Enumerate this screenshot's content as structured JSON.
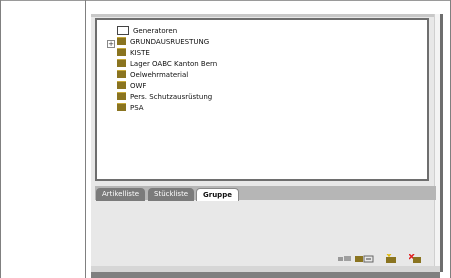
{
  "tree": {
    "items": [
      {
        "label": "Generatoren",
        "type": "root"
      },
      {
        "label": "GRUNDAUSRUESTUNG",
        "type": "folder",
        "expandable": true
      },
      {
        "label": "KISTE",
        "type": "folder"
      },
      {
        "label": "Lager OABC Kanton Bern",
        "type": "folder"
      },
      {
        "label": "Oelwehrmaterial",
        "type": "folder"
      },
      {
        "label": "OWF",
        "type": "folder"
      },
      {
        "label": "Pers. Schutzausrüstung",
        "type": "folder"
      },
      {
        "label": "PSA",
        "type": "folder"
      }
    ],
    "expand_symbol": "+"
  },
  "tabs": [
    {
      "label": "Artikelliste",
      "active": false
    },
    {
      "label": "Stückliste",
      "active": false
    },
    {
      "label": "Gruppe",
      "active": true
    }
  ],
  "toolbar": {
    "icons": [
      "move-group-icon",
      "add-group-icon",
      "new-group-icon",
      "delete-group-icon"
    ]
  },
  "colors": {
    "folder": "#8a7420",
    "delete": "#e02020",
    "tab_active_bg": "#ffffff",
    "tab_inactive_bg": "#7b7b7b"
  }
}
